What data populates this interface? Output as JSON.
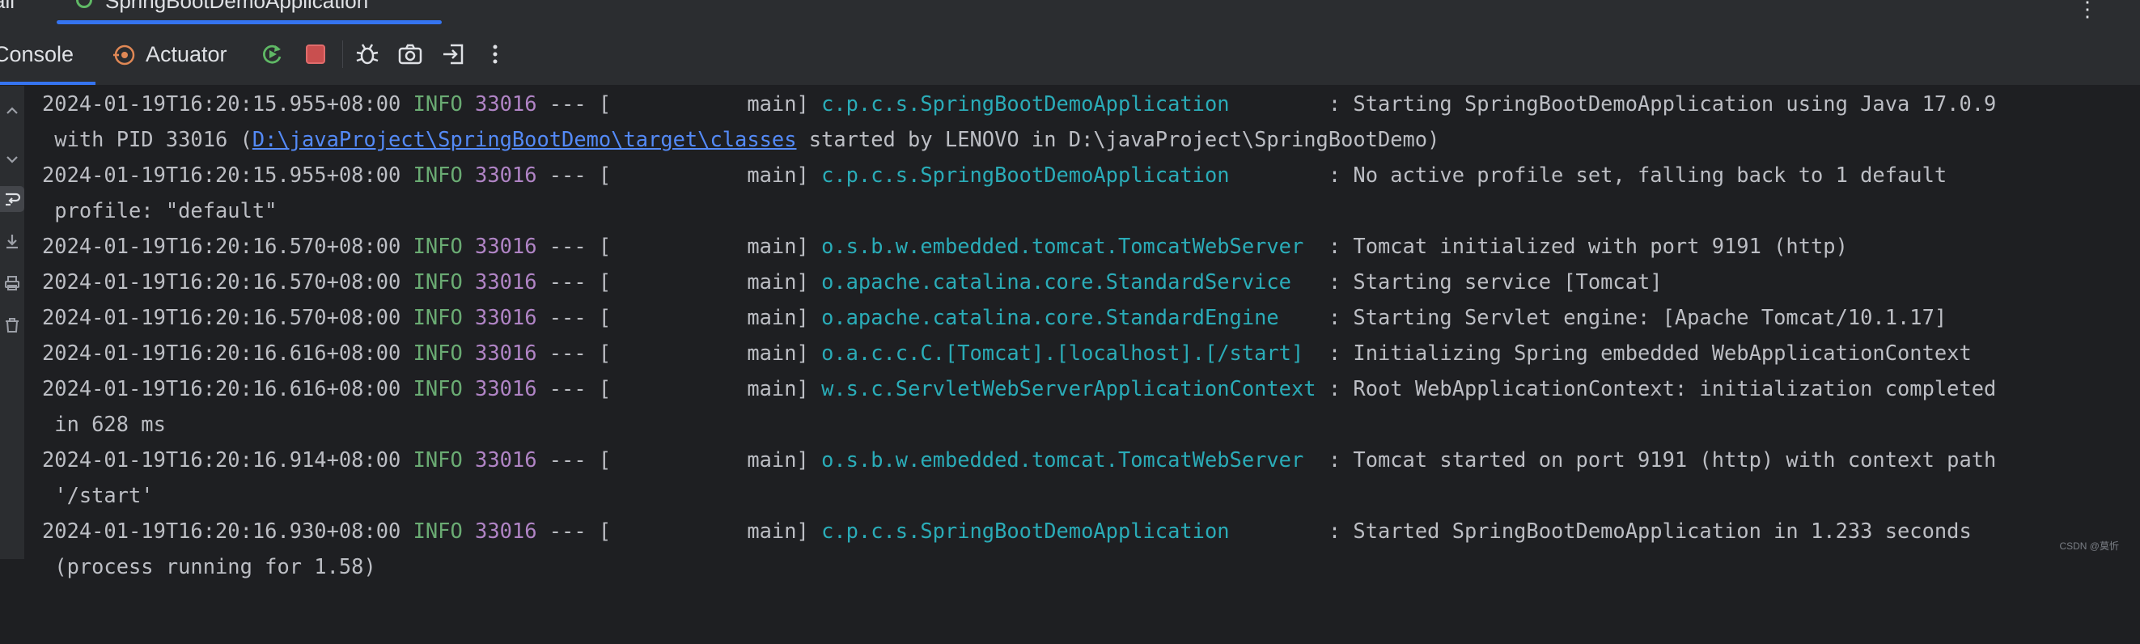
{
  "top_tabs": [
    {
      "label": "ail"
    },
    {
      "label": "SpringBootDemoApplication"
    }
  ],
  "toolbar": {
    "tabs": [
      {
        "label": "Console"
      },
      {
        "label": "Actuator"
      }
    ]
  },
  "icons": {
    "top_tab_icon": "spring-leaf-icon",
    "actuator_icon": "actuator-icon",
    "rerun": "rerun-icon",
    "stop": "stop-icon",
    "debug": "debug-icon",
    "screenshot": "camera-icon",
    "exit": "exit-icon",
    "more": "more-vertical-icon"
  },
  "colors": {
    "background": "#1e1f22",
    "toolbar": "#2b2d30",
    "accent": "#3574f0",
    "info": "#6aab73",
    "pid": "#b084c5",
    "logger": "#2aacb8",
    "link": "#548af7",
    "stop": "#c94f4f",
    "rerun": "#5fb865"
  },
  "log": [
    {
      "ts": "2024-01-19T16:20:15.955+08:00",
      "level": " INFO",
      "pid": "33016",
      "sep": " --- [           main] ",
      "logger": "c.p.c.s.SpringBootDemoApplication       ",
      "msg": " : Starting SpringBootDemoApplication using Java 17.0.9",
      "wrap_before": " with PID 33016 (",
      "wrap_link": "D:\\javaProject\\SpringBootDemo\\target\\classes",
      "wrap_after": " started by LENOVO in D:\\javaProject\\SpringBootDemo)"
    },
    {
      "ts": "2024-01-19T16:20:15.955+08:00",
      "level": " INFO",
      "pid": "33016",
      "sep": " --- [           main] ",
      "logger": "c.p.c.s.SpringBootDemoApplication       ",
      "msg": " : No active profile set, falling back to 1 default",
      "wrap_before": " profile: \"default\""
    },
    {
      "ts": "2024-01-19T16:20:16.570+08:00",
      "level": " INFO",
      "pid": "33016",
      "sep": " --- [           main] ",
      "logger": "o.s.b.w.embedded.tomcat.TomcatWebServer ",
      "msg": " : Tomcat initialized with port 9191 (http)"
    },
    {
      "ts": "2024-01-19T16:20:16.570+08:00",
      "level": " INFO",
      "pid": "33016",
      "sep": " --- [           main] ",
      "logger": "o.apache.catalina.core.StandardService  ",
      "msg": " : Starting service [Tomcat]"
    },
    {
      "ts": "2024-01-19T16:20:16.570+08:00",
      "level": " INFO",
      "pid": "33016",
      "sep": " --- [           main] ",
      "logger": "o.apache.catalina.core.StandardEngine   ",
      "msg": " : Starting Servlet engine: [Apache Tomcat/10.1.17]"
    },
    {
      "ts": "2024-01-19T16:20:16.616+08:00",
      "level": " INFO",
      "pid": "33016",
      "sep": " --- [           main] ",
      "logger": "o.a.c.c.C.[Tomcat].[localhost].[/start] ",
      "msg": " : Initializing Spring embedded WebApplicationContext"
    },
    {
      "ts": "2024-01-19T16:20:16.616+08:00",
      "level": " INFO",
      "pid": "33016",
      "sep": " --- [           main] ",
      "logger": "w.s.c.ServletWebServerApplicationContext",
      "msg": " : Root WebApplicationContext: initialization completed",
      "wrap_before": " in 628 ms"
    },
    {
      "ts": "2024-01-19T16:20:16.914+08:00",
      "level": " INFO",
      "pid": "33016",
      "sep": " --- [           main] ",
      "logger": "o.s.b.w.embedded.tomcat.TomcatWebServer ",
      "msg": " : Tomcat started on port 9191 (http) with context path",
      "wrap_before": " '/start'"
    },
    {
      "ts": "2024-01-19T16:20:16.930+08:00",
      "level": " INFO",
      "pid": "33016",
      "sep": " --- [           main] ",
      "logger": "c.p.c.s.SpringBootDemoApplication       ",
      "msg": " : Started SpringBootDemoApplication in 1.233 seconds",
      "wrap_before": " (process running for 1.58)"
    }
  ],
  "watermark": "CSDN @莫忻"
}
